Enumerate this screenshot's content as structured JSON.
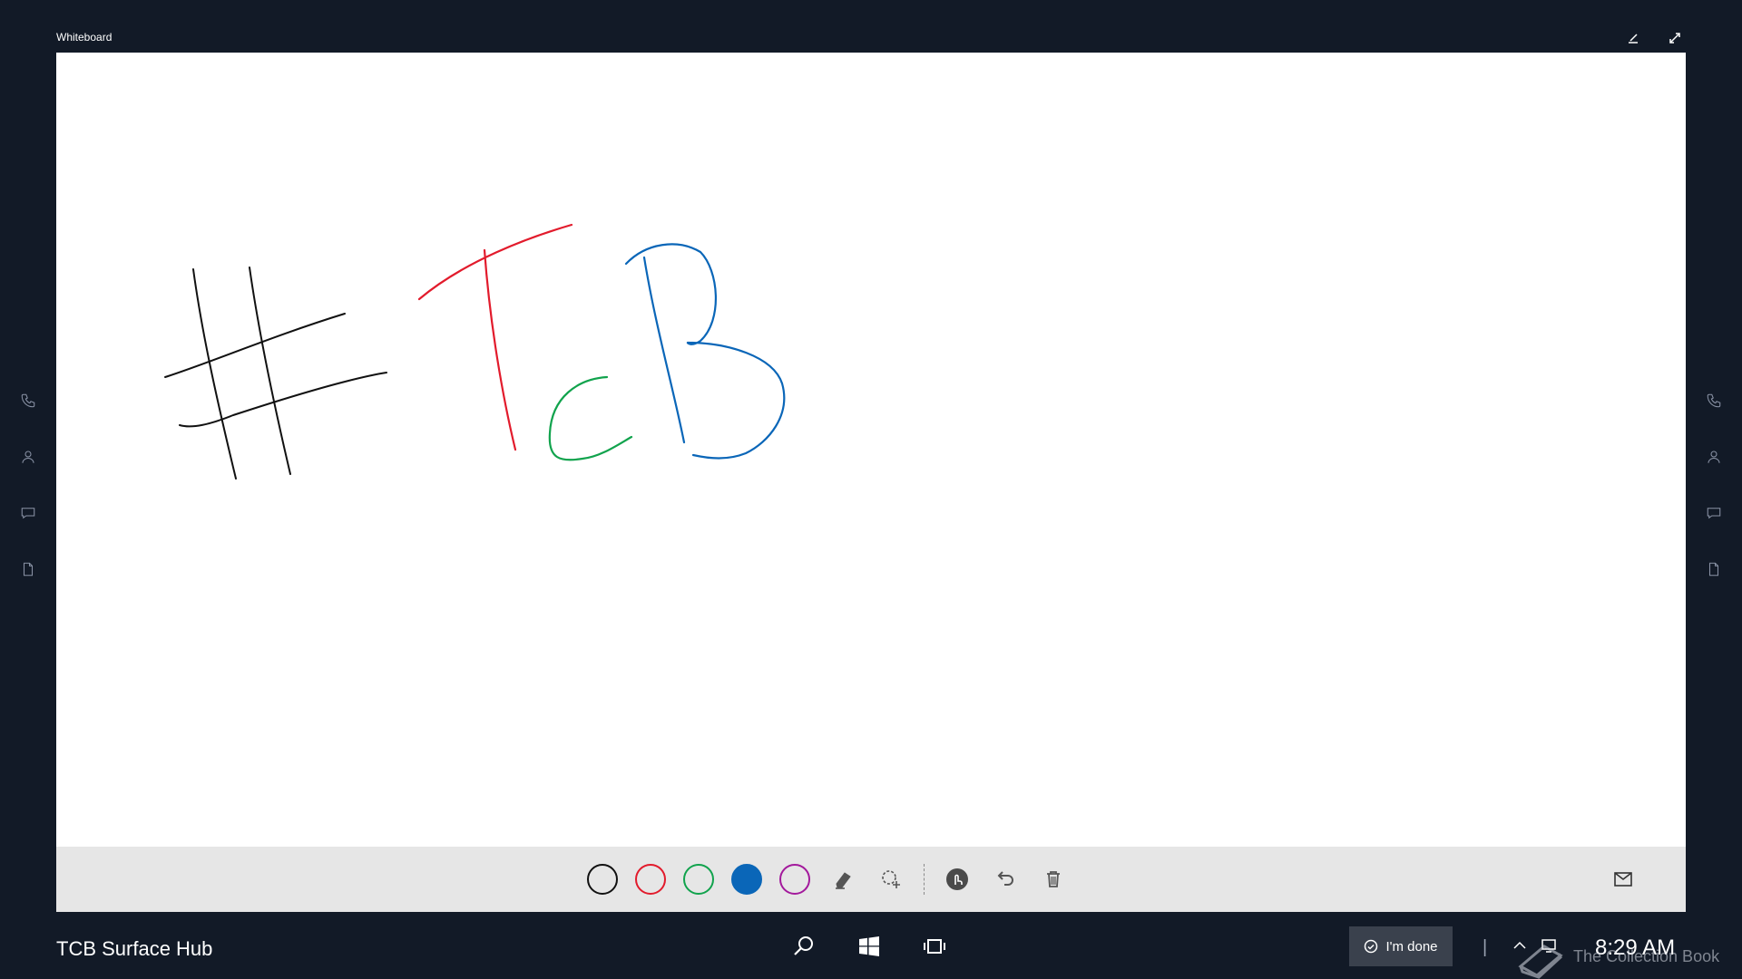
{
  "window": {
    "title": "Whiteboard"
  },
  "rails": {
    "items": [
      "phone-icon",
      "person-icon",
      "chat-icon",
      "document-icon"
    ]
  },
  "canvas": {
    "strokes": [
      {
        "name": "hash-stroke",
        "color": "#111111"
      },
      {
        "name": "T-stroke",
        "color": "#e21b2c"
      },
      {
        "name": "c-stroke",
        "color": "#11a34d"
      },
      {
        "name": "B-stroke",
        "color": "#0a66b8"
      }
    ]
  },
  "toolbar": {
    "pens": [
      {
        "name": "black",
        "color": "#111111",
        "selected": false
      },
      {
        "name": "red",
        "color": "#e21b2c",
        "selected": false
      },
      {
        "name": "green",
        "color": "#11a34d",
        "selected": false
      },
      {
        "name": "blue",
        "color": "#0a66b8",
        "selected": true
      },
      {
        "name": "purple",
        "color": "#a3199c",
        "selected": false
      }
    ],
    "tools": [
      "eraser-icon",
      "lasso-select-icon",
      "touch-icon",
      "undo-icon",
      "trash-icon",
      "mail-icon"
    ]
  },
  "taskbar": {
    "device_name": "TCB Surface Hub",
    "done_label": "I'm done",
    "time": "8:29 AM",
    "divider": "|"
  },
  "watermark": {
    "text": "The Collection Book"
  }
}
